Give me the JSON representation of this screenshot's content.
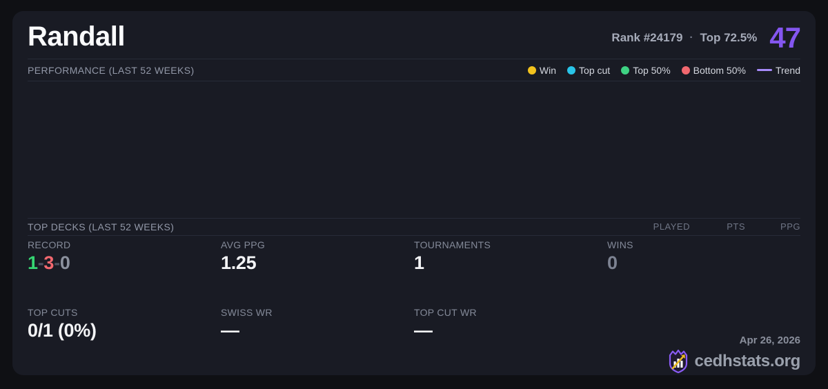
{
  "header": {
    "title": "Randall",
    "rank": "Rank #24179",
    "separator": "·",
    "top_percent": "Top 72.5%",
    "score": "47"
  },
  "performance": {
    "label": "PERFORMANCE (LAST 52 WEEKS)",
    "legend": [
      {
        "label": "Win",
        "color_key": "win"
      },
      {
        "label": "Top cut",
        "color_key": "top_cut"
      },
      {
        "label": "Top 50%",
        "color_key": "top_50"
      },
      {
        "label": "Bottom 50%",
        "color_key": "bottom_50"
      }
    ],
    "trend_label": "Trend",
    "chart_points": []
  },
  "top_decks": {
    "label": "TOP DECKS (LAST 52 WEEKS)",
    "columns": [
      "PLAYED",
      "PTS",
      "PPG"
    ]
  },
  "stats": {
    "record": {
      "label": "RECORD",
      "wins": "1",
      "losses": "3",
      "draws": "0",
      "sep": "-"
    },
    "avg_ppg": {
      "label": "AVG PPG",
      "value": "1.25"
    },
    "tournaments": {
      "label": "TOURNAMENTS",
      "value": "1"
    },
    "wins": {
      "label": "WINS",
      "value": "0"
    },
    "top_cuts": {
      "label": "TOP CUTS",
      "value": "0/1 (0%)"
    },
    "swiss_wr": {
      "label": "SWISS WR",
      "value": "—"
    },
    "top_cut_wr": {
      "label": "TOP CUT WR",
      "value": "—"
    }
  },
  "footer": {
    "date": "Apr 26, 2026",
    "site": "cedhstats.org"
  },
  "colors": {
    "win": "#f2c21d",
    "top_cut": "#29c4e8",
    "top_50": "#3ed283",
    "bottom_50": "#f2686f",
    "trend": "#a78bfa",
    "accent": "#8456f0"
  }
}
